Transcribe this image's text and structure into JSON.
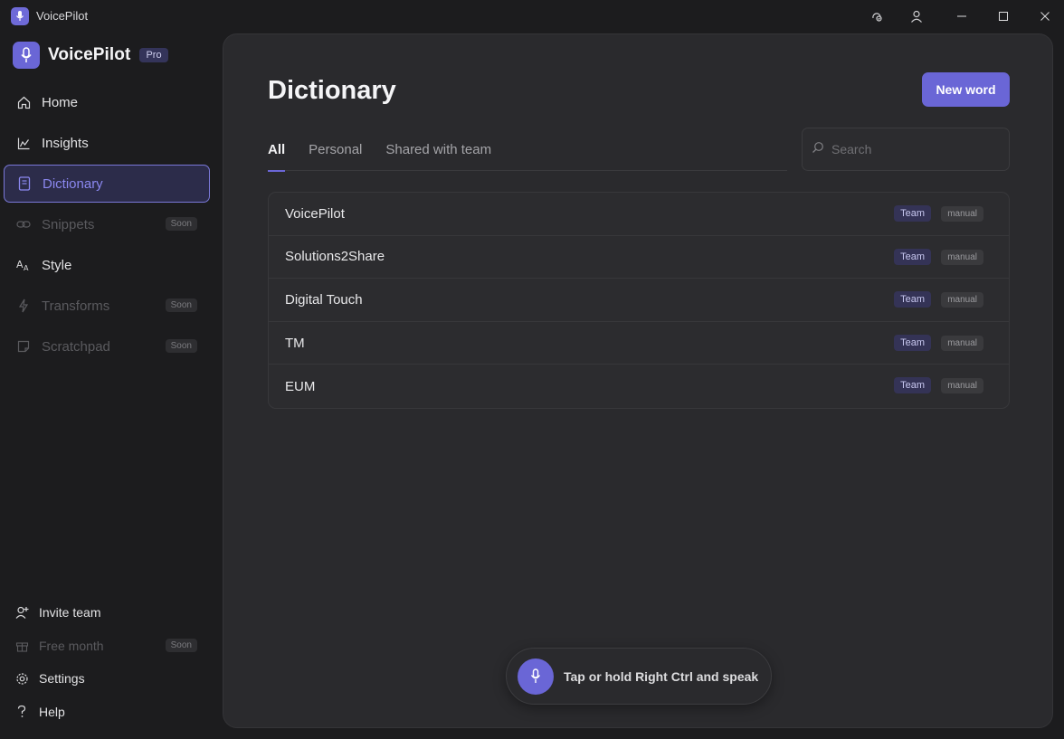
{
  "window": {
    "title": "VoicePilot"
  },
  "brand": {
    "name": "VoicePilot",
    "badge": "Pro"
  },
  "sidebar": {
    "items": [
      {
        "label": "Home",
        "icon": "home-icon",
        "state": "normal"
      },
      {
        "label": "Insights",
        "icon": "chart-icon",
        "state": "normal"
      },
      {
        "label": "Dictionary",
        "icon": "book-icon",
        "state": "active"
      },
      {
        "label": "Snippets",
        "icon": "link-icon",
        "state": "disabled",
        "badge": "Soon"
      },
      {
        "label": "Style",
        "icon": "text-style-icon",
        "state": "normal"
      },
      {
        "label": "Transforms",
        "icon": "lightning-icon",
        "state": "disabled",
        "badge": "Soon"
      },
      {
        "label": "Scratchpad",
        "icon": "note-icon",
        "state": "disabled",
        "badge": "Soon"
      }
    ],
    "bottom_items": [
      {
        "label": "Invite team",
        "icon": "user-add-icon",
        "state": "normal"
      },
      {
        "label": "Free month",
        "icon": "gift-icon",
        "state": "disabled",
        "badge": "Soon"
      },
      {
        "label": "Settings",
        "icon": "gear-icon",
        "state": "normal"
      },
      {
        "label": "Help",
        "icon": "question-icon",
        "state": "normal"
      }
    ]
  },
  "main": {
    "title": "Dictionary",
    "new_word_label": "New word",
    "tabs": [
      {
        "label": "All",
        "active": true
      },
      {
        "label": "Personal",
        "active": false
      },
      {
        "label": "Shared with team",
        "active": false
      }
    ],
    "search": {
      "placeholder": "Search",
      "value": ""
    },
    "words": [
      {
        "word": "VoicePilot",
        "scope": "Team",
        "source": "manual"
      },
      {
        "word": "Solutions2Share",
        "scope": "Team",
        "source": "manual"
      },
      {
        "word": "Digital Touch",
        "scope": "Team",
        "source": "manual"
      },
      {
        "word": "TM",
        "scope": "Team",
        "source": "manual"
      },
      {
        "word": "EUM",
        "scope": "Team",
        "source": "manual"
      }
    ]
  },
  "voice_bar": {
    "text": "Tap or hold Right Ctrl and speak"
  },
  "colors": {
    "accent": "#6a66d6",
    "background": "#1c1c1e",
    "panel": "#2a2a2d"
  }
}
